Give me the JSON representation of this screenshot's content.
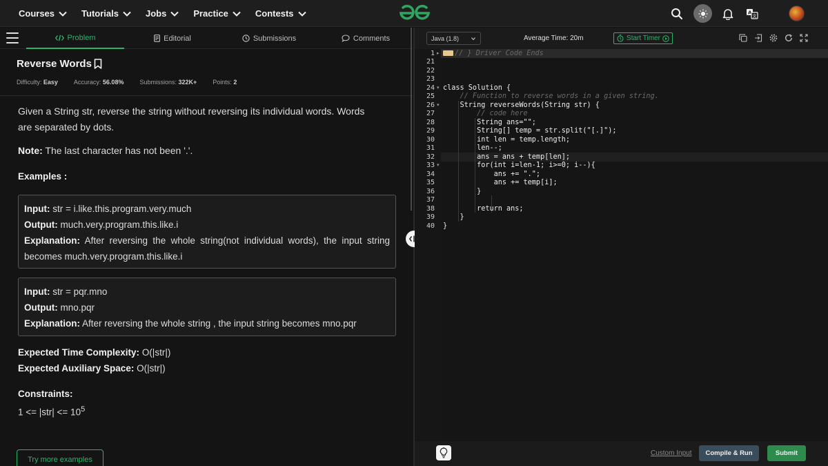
{
  "nav": {
    "menu": [
      "Courses",
      "Tutorials",
      "Jobs",
      "Practice",
      "Contests"
    ],
    "logo": "GfG",
    "icons": [
      "search-icon",
      "theme-toggle-icon",
      "bell-icon",
      "translate-icon",
      "avatar"
    ]
  },
  "tabs": {
    "problem": "Problem",
    "editorial": "Editorial",
    "submissions": "Submissions",
    "comments": "Comments"
  },
  "problem": {
    "title": "Reverse Words",
    "difficulty_label": "Difficulty:",
    "difficulty": "Easy",
    "accuracy_label": "Accuracy:",
    "accuracy": "56.08%",
    "submissions_label": "Submissions:",
    "submissions": "322K+",
    "points_label": "Points:",
    "points": "2",
    "statement": "Given a String str, reverse the string without reversing its individual words. Words are separated by dots.",
    "note_label": "Note:",
    "note": " The last character has not been '.'.",
    "examples_heading": "Examples :",
    "examples": [
      {
        "input_label": "Input:",
        "input": " str  =  i.like.this.program.very.much",
        "output_label": "Output:",
        "output": " much.very.program.this.like.i",
        "explanation_label": "Explanation:",
        "explanation": " After reversing the whole string(not individual words), the input string becomes  much.very.program.this.like.i"
      },
      {
        "input_label": "Input:",
        "input": " str  =  pqr.mno",
        "output_label": "Output:",
        "output": " mno.pqr",
        "explanation_label": "Explanation:",
        "explanation": " After reversing the whole string , the input string becomes mno.pqr"
      }
    ],
    "time_complexity_label": "Expected Time Complexity:",
    "time_complexity": " O(|str|)",
    "aux_space_label": "Expected Auxiliary Space:",
    "aux_space": " O(|str|)",
    "constraints_label": "Constraints:",
    "constraint_prefix": "1 <= |str| <= 10",
    "constraint_exp": "5",
    "try_more": "Try more examples"
  },
  "editor": {
    "language": "Java (1.8)",
    "avg_time": "Average Time: 20m",
    "start_timer": "Start Timer",
    "toolbar_icons": [
      "copy-icon",
      "import-icon",
      "settings-icon",
      "reset-icon",
      "fullscreen-icon"
    ],
    "lines": [
      {
        "n": "1",
        "fold": "▸",
        "code": "// } Driver Code Ends",
        "cls": "c-cm"
      },
      {
        "n": "21",
        "fold": "",
        "code": "",
        "cls": ""
      },
      {
        "n": "22",
        "fold": "",
        "code": "",
        "cls": ""
      },
      {
        "n": "23",
        "fold": "",
        "code": "",
        "cls": ""
      },
      {
        "n": "24",
        "fold": "▾",
        "code": "class Solution {",
        "cls": ""
      },
      {
        "n": "25",
        "fold": "",
        "code": "    // Function to reverse words in a given string.",
        "cls": "c-cm"
      },
      {
        "n": "26",
        "fold": "▾",
        "code": "    String reverseWords(String str) {",
        "cls": ""
      },
      {
        "n": "27",
        "fold": "",
        "code": "        // code here",
        "cls": "c-cm"
      },
      {
        "n": "28",
        "fold": "",
        "code": "        String ans=\"\";",
        "cls": ""
      },
      {
        "n": "29",
        "fold": "",
        "code": "        String[] temp = str.split(\"[.]\");",
        "cls": ""
      },
      {
        "n": "30",
        "fold": "",
        "code": "        int len = temp.length;",
        "cls": ""
      },
      {
        "n": "31",
        "fold": "",
        "code": "        len--;",
        "cls": ""
      },
      {
        "n": "32",
        "fold": "",
        "code": "        ans = ans + temp[len];",
        "cls": ""
      },
      {
        "n": "33",
        "fold": "▾",
        "code": "        for(int i=len-1; i>=0; i--){",
        "cls": ""
      },
      {
        "n": "34",
        "fold": "",
        "code": "            ans += \".\";",
        "cls": ""
      },
      {
        "n": "35",
        "fold": "",
        "code": "            ans += temp[i];",
        "cls": ""
      },
      {
        "n": "36",
        "fold": "",
        "code": "        }",
        "cls": ""
      },
      {
        "n": "37",
        "fold": "",
        "code": "",
        "cls": ""
      },
      {
        "n": "38",
        "fold": "",
        "code": "        return ans;",
        "cls": ""
      },
      {
        "n": "39",
        "fold": "",
        "code": "    }",
        "cls": ""
      },
      {
        "n": "40",
        "fold": "",
        "code": "}",
        "cls": ""
      }
    ],
    "custom_input": "Custom Input",
    "compile_run": "Compile & Run",
    "submit": "Submit"
  },
  "colors": {
    "accent_green": "#2fb36b",
    "background": "#131313",
    "compile_button": "#3a4d5c",
    "submit_button": "#2e8b4e"
  }
}
